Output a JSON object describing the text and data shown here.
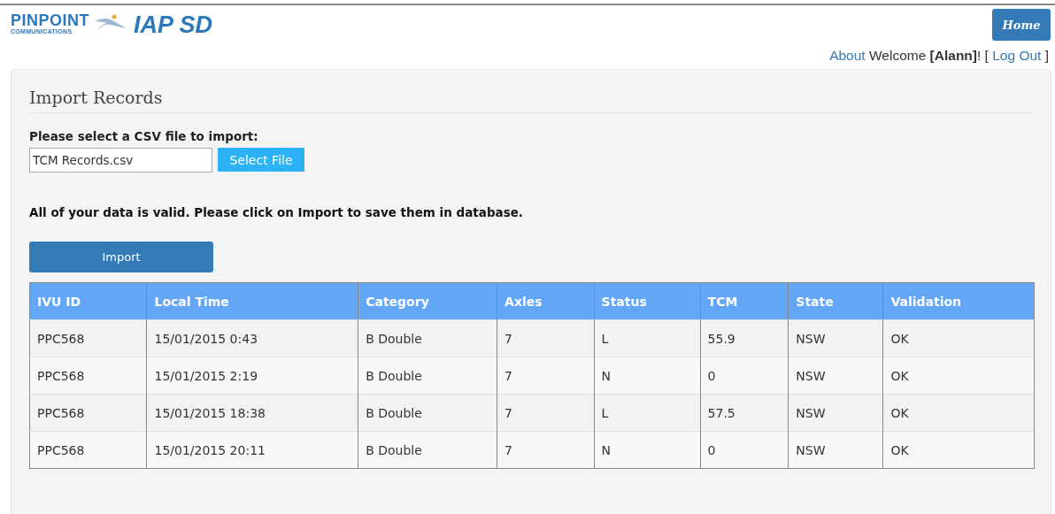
{
  "header": {
    "brand": "PINPOINT",
    "brand_sub": "COMMUNICATIONS",
    "app_title": "IAP SD",
    "home_button": "Home"
  },
  "user_bar": {
    "about_link": "About",
    "welcome": " Welcome **[Alann]**! [ ",
    "logout_link": "Log Out",
    "closing": " ]"
  },
  "panel": {
    "title": "Import Records",
    "file_label": "Please select a CSV file to import:",
    "file_value": "TCM Records.csv",
    "select_button": "Select File",
    "message": "All of your data is valid. Please click on Import to save them in database.",
    "import_button": "Import"
  },
  "table": {
    "columns": [
      "IVU ID",
      "Local Time",
      "Category",
      "Axles",
      "Status",
      "TCM",
      "State",
      "Validation"
    ],
    "rows": [
      [
        "PPC568",
        "15/01/2015 0:43",
        "B Double",
        "7",
        "L",
        "55.9",
        "NSW",
        "OK"
      ],
      [
        "PPC568",
        "15/01/2015 2:19",
        "B Double",
        "7",
        "N",
        "0",
        "NSW",
        "OK"
      ],
      [
        "PPC568",
        "15/01/2015 18:38",
        "B Double",
        "7",
        "L",
        "57.5",
        "NSW",
        "OK"
      ],
      [
        "PPC568",
        "15/01/2015 20:11",
        "B Double",
        "7",
        "N",
        "0",
        "NSW",
        "OK"
      ]
    ]
  }
}
